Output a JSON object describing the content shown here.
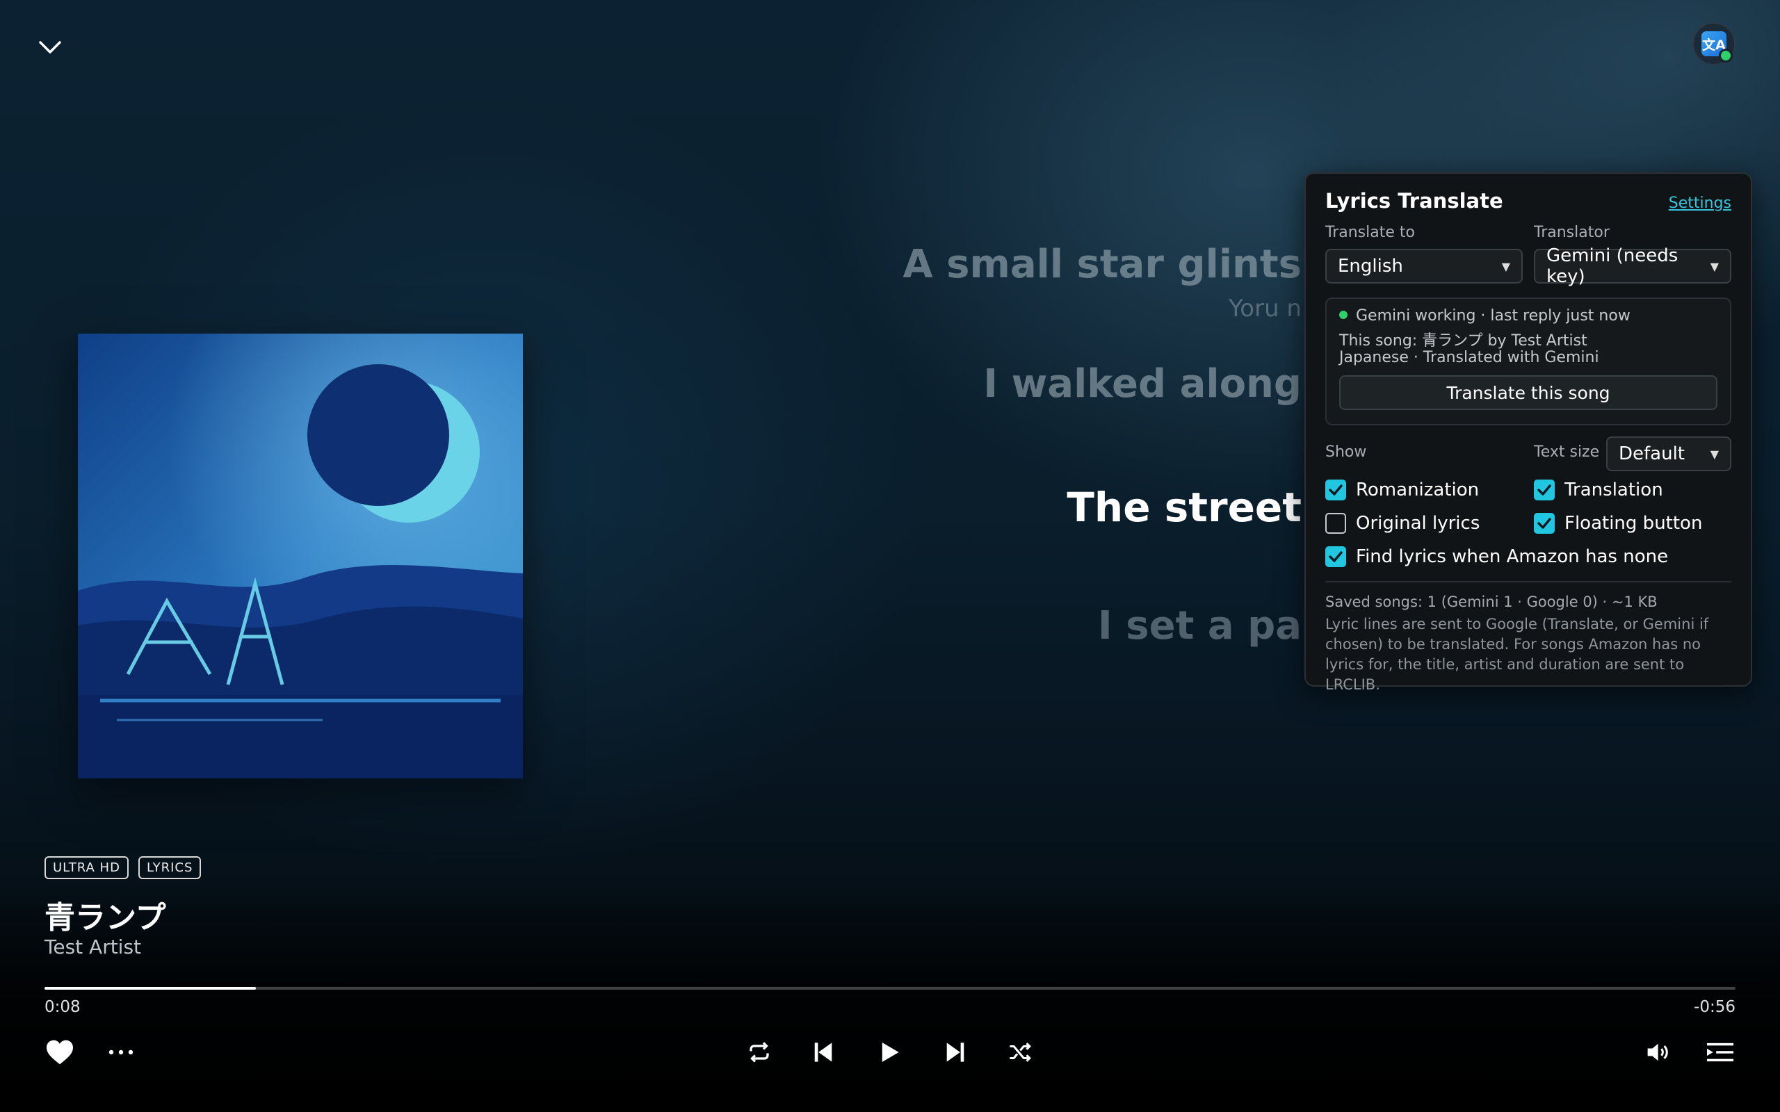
{
  "colors": {
    "accent": "#21c7e0",
    "status_ok": "#2fd06a",
    "link": "#38c4dc"
  },
  "icons": {
    "collapse": "chevron-down-icon",
    "extension": "translate-icon",
    "like": "heart-icon",
    "more": "more-dots-icon",
    "repeat": "repeat-icon",
    "prev": "skip-previous-icon",
    "play": "play-icon",
    "next": "skip-next-icon",
    "shuffle": "shuffle-icon",
    "volume": "volume-icon",
    "queue": "queue-icon"
  },
  "extension_button": {
    "glyph": "文A"
  },
  "lyrics": {
    "line1": "A small star glints",
    "line1_romaji": "Yoru n",
    "line2": "I walked along",
    "line3_active": "The street",
    "line4": "I set a pa"
  },
  "track": {
    "badges": [
      "ULTRA HD",
      "LYRICS"
    ],
    "title": "青ランプ",
    "artist": "Test Artist"
  },
  "playback": {
    "elapsed": "0:08",
    "remaining": "-0:56",
    "progress_fraction": 0.125
  },
  "panel": {
    "title": "Lyrics Translate",
    "settings_link": "Settings",
    "translate_to_label": "Translate to",
    "translate_to_value": "English",
    "translator_label": "Translator",
    "translator_value": "Gemini (needs key)",
    "status_line": "Gemini working · last reply just now",
    "song_line": "This song: 青ランプ by Test Artist",
    "lang_line": "Japanese · Translated with Gemini",
    "translate_button": "Translate this song",
    "show_label": "Show",
    "text_size_label": "Text size",
    "text_size_value": "Default",
    "options": {
      "romanization": {
        "label": "Romanization",
        "checked": true
      },
      "translation": {
        "label": "Translation",
        "checked": true
      },
      "original": {
        "label": "Original lyrics",
        "checked": false
      },
      "floating": {
        "label": "Floating button",
        "checked": true
      },
      "find_lyrics": {
        "label": "Find lyrics when Amazon has none",
        "checked": true
      }
    },
    "saved_songs": "Saved songs: 1 (Gemini 1 · Google 0) · ~1 KB",
    "privacy_note": "Lyric lines are sent to Google (Translate, or Gemini if chosen) to be translated. For songs Amazon has no lyrics for, the title, artist and duration are sent to LRCLIB."
  }
}
